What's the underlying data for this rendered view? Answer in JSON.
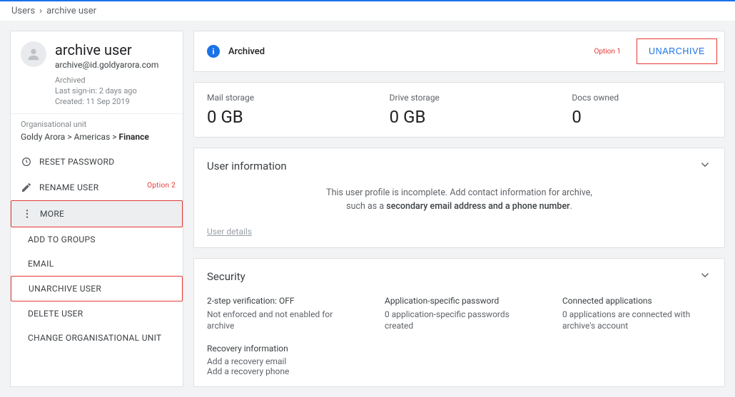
{
  "breadcrumb": {
    "root": "Users",
    "current": "archive user"
  },
  "profile": {
    "name": "archive user",
    "email": "archive@id.goldyarora.com",
    "status": "Archived",
    "last_signin": "Last sign-in: 2 days ago",
    "created": "Created: 11 Sep 2019"
  },
  "orgunit": {
    "label": "Organisational unit",
    "path_root": "Goldy Arora",
    "path_mid": "Americas",
    "path_leaf": "Finance"
  },
  "actions": {
    "reset_password": "RESET PASSWORD",
    "rename_user": "RENAME USER",
    "more": "MORE",
    "add_to_groups": "ADD TO GROUPS",
    "email": "EMAIL",
    "unarchive_user": "UNARCHIVE USER",
    "delete_user": "DELETE USER",
    "change_ou": "CHANGE ORGANISATIONAL UNIT",
    "option2_tag": "Option 2"
  },
  "banner": {
    "status": "Archived",
    "option1_tag": "Option 1",
    "unarchive_btn": "UNARCHIVE"
  },
  "stats": {
    "mail_label": "Mail storage",
    "mail_value": "0 GB",
    "drive_label": "Drive storage",
    "drive_value": "0 GB",
    "docs_label": "Docs owned",
    "docs_value": "0"
  },
  "userinfo": {
    "title": "User information",
    "body_prefix": "This user profile is incomplete. Add contact information for archive, such as a ",
    "body_bold": "secondary email address and a phone number",
    "body_suffix": ".",
    "details_link": "User details"
  },
  "security": {
    "title": "Security",
    "twostep_label": "2-step verification: OFF",
    "twostep_body": "Not enforced and not enabled for archive",
    "asp_label": "Application-specific password",
    "asp_body": "0 application-specific passwords created",
    "apps_label": "Connected applications",
    "apps_body": "0 applications are connected with archive's account",
    "recovery_label": "Recovery information",
    "recovery_email": "Add a recovery email",
    "recovery_phone": "Add a recovery phone"
  }
}
